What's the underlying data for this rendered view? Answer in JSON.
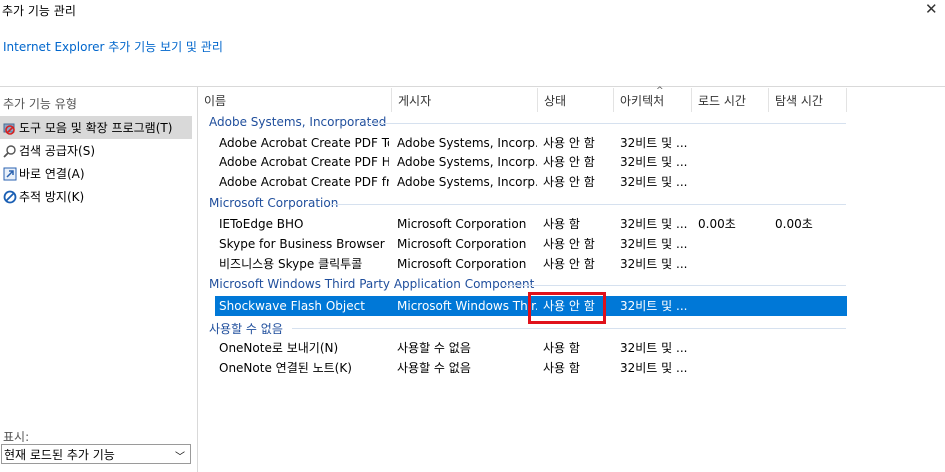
{
  "window": {
    "title": "추가 기능 관리",
    "subtitle": "Internet Explorer 추가 기능 보기 및 관리"
  },
  "left_pane": {
    "heading": "추가 기능 유형",
    "categories": [
      {
        "label": "도구 모음 및 확장 프로그램(T)",
        "icon": "toolbar-extension-icon",
        "selected": true
      },
      {
        "label": "검색 공급자(S)",
        "icon": "search-icon",
        "selected": false
      },
      {
        "label": "바로 연결(A)",
        "icon": "accelerator-icon",
        "selected": false
      },
      {
        "label": "추적 방지(K)",
        "icon": "tracking-protection-icon",
        "selected": false
      }
    ],
    "show_label": "표시:",
    "show_value": "현재 로드된 추가 기능"
  },
  "columns": [
    "이름",
    "게시자",
    "상태",
    "아키텍처",
    "로드 시간",
    "탐색 시간"
  ],
  "groups": [
    {
      "name": "Adobe Systems, Incorporated",
      "rows": [
        [
          "Adobe Acrobat Create PDF To...",
          "Adobe Systems, Incorp...",
          "사용 안 함",
          "32비트 및 ...",
          "",
          ""
        ],
        [
          "Adobe Acrobat Create PDF Hel...",
          "Adobe Systems, Incorp...",
          "사용 안 함",
          "32비트 및 ...",
          "",
          ""
        ],
        [
          "Adobe Acrobat Create PDF fro...",
          "Adobe Systems, Incorp...",
          "사용 안 함",
          "32비트 및 ...",
          "",
          ""
        ]
      ]
    },
    {
      "name": "Microsoft Corporation",
      "rows": [
        [
          "IEToEdge BHO",
          "Microsoft Corporation",
          "사용 함",
          "32비트 및 ...",
          "0.00초",
          "0.00초"
        ],
        [
          "Skype for Business Browser He...",
          "Microsoft Corporation",
          "사용 안 함",
          "32비트 및 ...",
          "",
          ""
        ],
        [
          "비즈니스용 Skype 클릭투콜",
          "Microsoft Corporation",
          "사용 안 함",
          "32비트 및 ...",
          "",
          ""
        ]
      ]
    },
    {
      "name": "Microsoft Windows Third Party Application Component",
      "rows": [
        [
          "Shockwave Flash Object",
          "Microsoft Windows Thir...",
          "사용 안 함",
          "32비트 및 ...",
          "",
          ""
        ]
      ]
    },
    {
      "name": "사용할 수 없음",
      "rows": [
        [
          "OneNote로 보내기(N)",
          "사용할 수 없음",
          "사용 함",
          "32비트 및 ...",
          "",
          ""
        ],
        [
          "OneNote 연결된 노트(K)",
          "사용할 수 없음",
          "사용 함",
          "32비트 및 ...",
          "",
          ""
        ]
      ]
    }
  ],
  "selected_row": "Shockwave Flash Object",
  "colors": {
    "selection": "#0078d7",
    "highlight_box": "#e0111b",
    "link": "#0066cc",
    "group_header": "#1f4e9c"
  }
}
